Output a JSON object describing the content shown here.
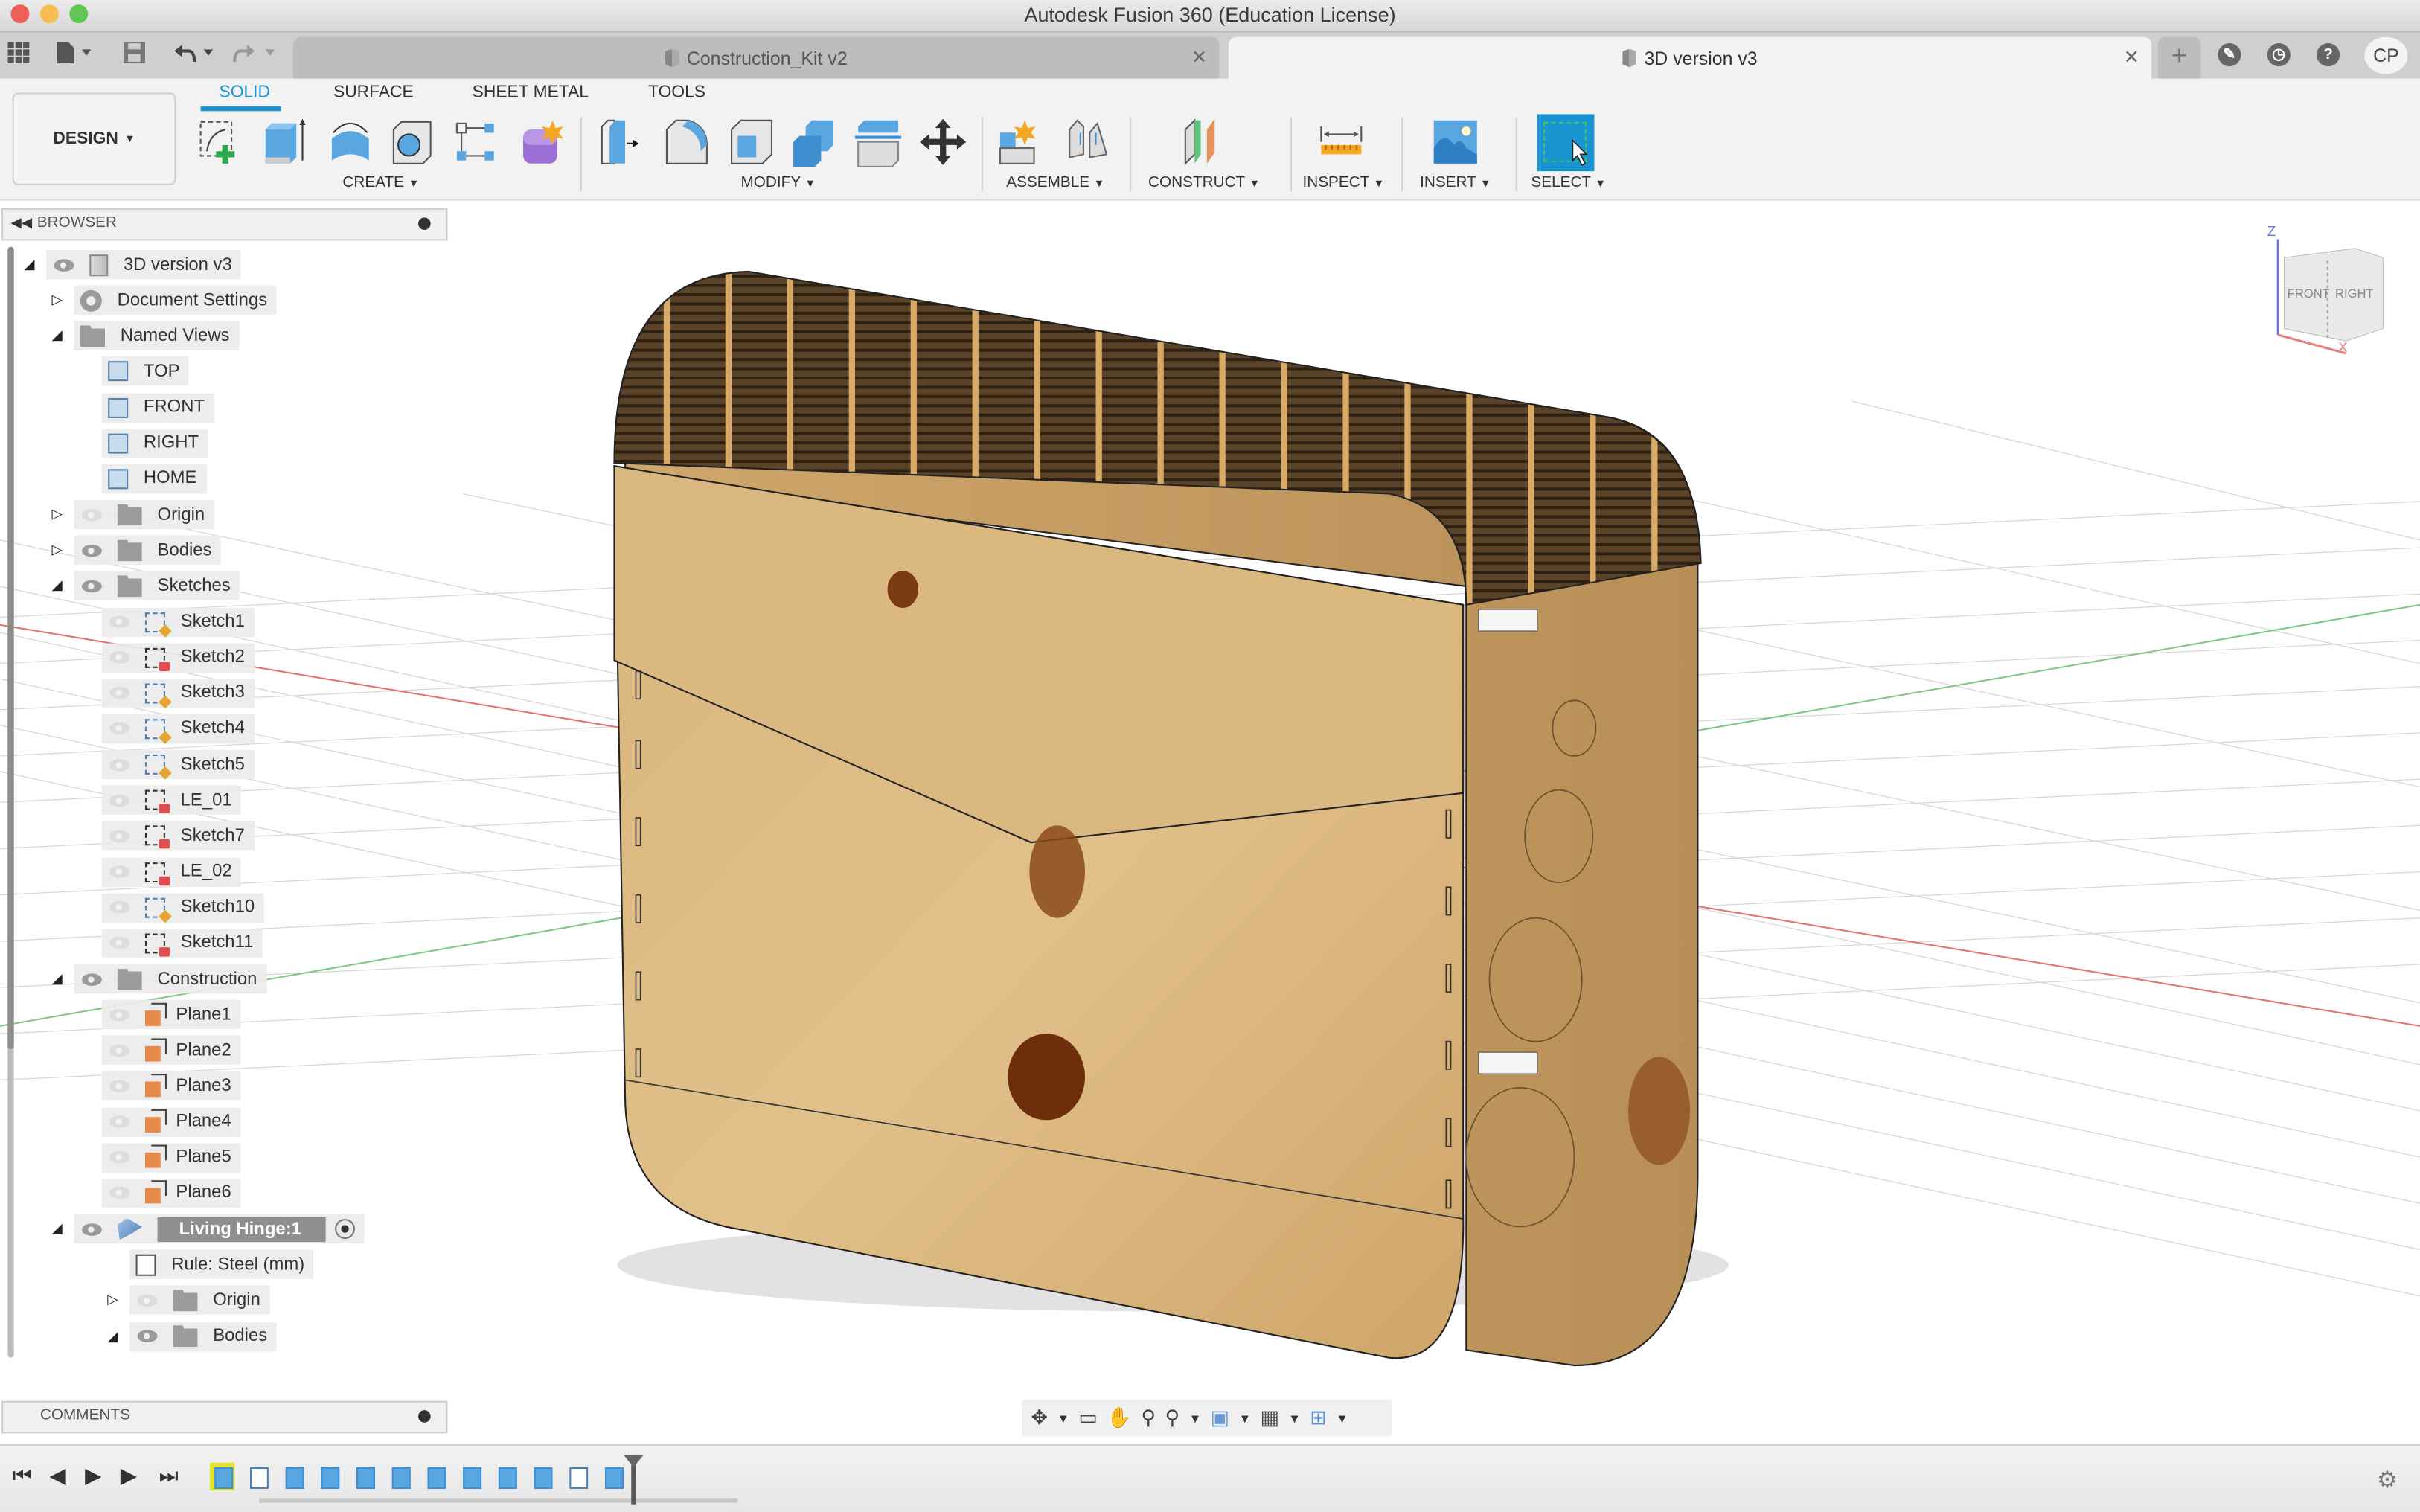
{
  "window": {
    "title": "Autodesk Fusion 360 (Education License)"
  },
  "quick_access": {
    "icons": [
      "apps-grid-icon",
      "file-icon",
      "save-icon",
      "undo-icon",
      "redo-icon"
    ]
  },
  "tabs": [
    {
      "label": "Construction_Kit v2",
      "active": false
    },
    {
      "label": "3D version v3",
      "active": true
    }
  ],
  "top_right": {
    "new_tab": "+",
    "user_initials": "CP"
  },
  "workspace": {
    "label": "DESIGN"
  },
  "ribbon": {
    "tabs": [
      {
        "label": "SOLID",
        "active": true
      },
      {
        "label": "SURFACE",
        "active": false
      },
      {
        "label": "SHEET METAL",
        "active": false
      },
      {
        "label": "TOOLS",
        "active": false
      }
    ],
    "groups": [
      {
        "label": "CREATE",
        "tools": [
          "create-sketch",
          "extrude",
          "revolve",
          "hole",
          "pattern",
          "create-form"
        ]
      },
      {
        "label": "MODIFY",
        "tools": [
          "press-pull",
          "fillet",
          "shell",
          "combine",
          "split-body",
          "move-copy"
        ]
      },
      {
        "label": "ASSEMBLE",
        "tools": [
          "new-component",
          "joint"
        ]
      },
      {
        "label": "CONSTRUCT",
        "tools": [
          "offset-plane"
        ]
      },
      {
        "label": "INSPECT",
        "tools": [
          "measure"
        ]
      },
      {
        "label": "INSERT",
        "tools": [
          "insert-image"
        ]
      },
      {
        "label": "SELECT",
        "tools": [
          "window-select"
        ]
      }
    ]
  },
  "browser": {
    "title": "BROWSER",
    "tree": [
      {
        "label": "3D version v3",
        "type": "component",
        "expanded": true,
        "visible": true,
        "level": 0
      },
      {
        "label": "Document Settings",
        "type": "gear",
        "expanded": false,
        "level": 1
      },
      {
        "label": "Named Views",
        "type": "folder",
        "expanded": true,
        "level": 1
      },
      {
        "label": "TOP",
        "type": "view",
        "level": 2
      },
      {
        "label": "FRONT",
        "type": "view",
        "level": 2
      },
      {
        "label": "RIGHT",
        "type": "view",
        "level": 2
      },
      {
        "label": "HOME",
        "type": "view",
        "level": 2
      },
      {
        "label": "Origin",
        "type": "folder",
        "expanded": false,
        "visible": false,
        "level": 1
      },
      {
        "label": "Bodies",
        "type": "folder",
        "expanded": false,
        "visible": true,
        "level": 1
      },
      {
        "label": "Sketches",
        "type": "folder",
        "expanded": true,
        "visible": true,
        "level": 1
      },
      {
        "label": "Sketch1",
        "type": "sketch",
        "visible": false,
        "level": 2
      },
      {
        "label": "Sketch2",
        "type": "sketch-locked",
        "visible": false,
        "level": 2
      },
      {
        "label": "Sketch3",
        "type": "sketch",
        "visible": false,
        "level": 2
      },
      {
        "label": "Sketch4",
        "type": "sketch",
        "visible": false,
        "level": 2
      },
      {
        "label": "Sketch5",
        "type": "sketch",
        "visible": false,
        "level": 2
      },
      {
        "label": "LE_01",
        "type": "sketch-locked",
        "visible": false,
        "level": 2
      },
      {
        "label": "Sketch7",
        "type": "sketch-locked",
        "visible": false,
        "level": 2
      },
      {
        "label": "LE_02",
        "type": "sketch-locked",
        "visible": false,
        "level": 2
      },
      {
        "label": "Sketch10",
        "type": "sketch",
        "visible": false,
        "level": 2
      },
      {
        "label": "Sketch11",
        "type": "sketch-locked",
        "visible": false,
        "level": 2
      },
      {
        "label": "Construction",
        "type": "folder",
        "expanded": true,
        "visible": true,
        "level": 1
      },
      {
        "label": "Plane1",
        "type": "plane",
        "visible": false,
        "level": 2
      },
      {
        "label": "Plane2",
        "type": "plane",
        "visible": false,
        "level": 2
      },
      {
        "label": "Plane3",
        "type": "plane",
        "visible": false,
        "level": 2
      },
      {
        "label": "Plane4",
        "type": "plane",
        "visible": false,
        "level": 2
      },
      {
        "label": "Plane5",
        "type": "plane",
        "visible": false,
        "level": 2
      },
      {
        "label": "Plane6",
        "type": "plane",
        "visible": false,
        "level": 2
      },
      {
        "label": "Living Hinge:1",
        "type": "hinge-component",
        "expanded": true,
        "visible": true,
        "active": true,
        "level": 1
      },
      {
        "label": "Rule: Steel (mm)",
        "type": "rule",
        "level": 2
      },
      {
        "label": "Origin",
        "type": "folder",
        "expanded": false,
        "visible": false,
        "level": 2
      },
      {
        "label": "Bodies",
        "type": "folder",
        "expanded": true,
        "visible": true,
        "level": 2
      }
    ]
  },
  "comments": {
    "title": "COMMENTS"
  },
  "viewcube": {
    "faces": [
      "FRONT",
      "RIGHT"
    ],
    "axes": [
      "Z",
      "X"
    ]
  },
  "navbar": {
    "tools": [
      "orbit",
      "look-at",
      "pan",
      "zoom",
      "fit",
      "display-settings",
      "grid-snaps",
      "viewports"
    ]
  },
  "timeline": {
    "controls": [
      "go-to-start",
      "step-back",
      "play",
      "step-forward",
      "go-to-end"
    ],
    "features": [
      "surface-feature",
      "sketch",
      "combine",
      "extrude",
      "sheet-rule",
      "combine",
      "flange",
      "sheet-rule",
      "flange",
      "combine",
      "sketch",
      "extrude"
    ]
  },
  "colors": {
    "accent": "#1a94d0",
    "wood": "#d9b27a",
    "grid_x_axis": "#e57373",
    "grid_y_axis": "#81c784"
  }
}
